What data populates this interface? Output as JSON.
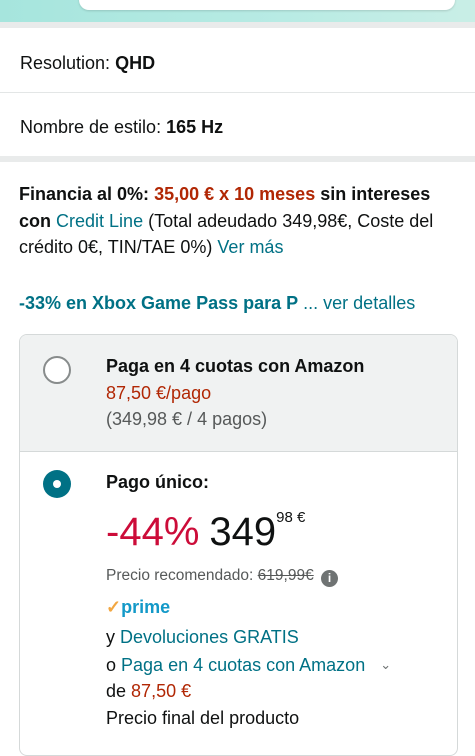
{
  "variations": [
    {
      "label": "Resolution:",
      "value": "QHD"
    },
    {
      "label": "Nombre de estilo:",
      "value": "165 Hz"
    }
  ],
  "financing": {
    "prefix": "Financia al 0%:",
    "amount": "35,00 € x 10 meses",
    "suffix": "sin intereses con",
    "provider": "Credit Line",
    "details": "(Total adeudado 349,98€, Coste del crédito 0€, TIN/TAE 0%)",
    "more_link": "Ver más"
  },
  "promo": {
    "text": "-33% en Xbox Game Pass para P",
    "link": "... ver detalles"
  },
  "payment_options": {
    "installments": {
      "title": "Paga en 4 cuotas con Amazon",
      "per_payment": "87,50 €/pago",
      "breakdown": "(349,98 € / 4 pagos)",
      "selected": false
    },
    "single": {
      "title": "Pago único:",
      "discount": "-44%",
      "price_whole": "349",
      "price_fraction": "98 €",
      "list_price_label": "Precio recomendado:",
      "list_price": "619,99€",
      "prime_check": "✓",
      "prime_word": "prime",
      "returns_prefix": "y",
      "returns_link": "Devoluciones GRATIS",
      "alt_prefix": "o",
      "alt_link": "Paga en 4 cuotas con Amazon",
      "alt_amount_prefix": "de",
      "alt_amount": "87,50 €",
      "final_note": "Precio final del producto",
      "selected": true
    }
  },
  "colors": {
    "link": "#007185",
    "price_red": "#b12704",
    "discount_red": "#cc0c39",
    "prime_blue": "#1399c8",
    "prime_check": "#f2a742"
  }
}
